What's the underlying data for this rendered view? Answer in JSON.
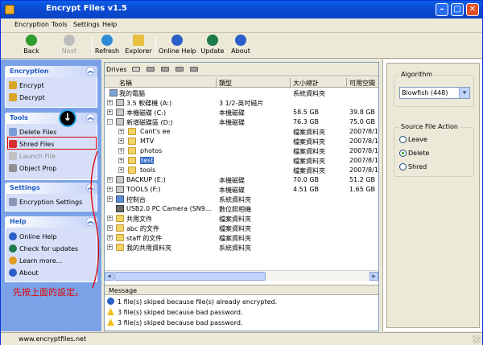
{
  "window": {
    "title": "Encrypt Files v1.5",
    "min_icon": "minimize-icon",
    "max_icon": "maximize-icon",
    "close_icon": "close-icon"
  },
  "menu": [
    {
      "label": "Encryption"
    },
    {
      "label": "Tools"
    },
    {
      "label": "Settings"
    },
    {
      "label": "Help"
    }
  ],
  "toolbar": {
    "back": "Back",
    "next": "Next",
    "refresh": "Refresh",
    "explorer": "Explorer",
    "online_help": "Online Help",
    "update": "Update",
    "about": "About"
  },
  "sidebar": {
    "encryption": {
      "header": "Encryption",
      "items": [
        "Encrypt",
        "Decrypt"
      ]
    },
    "tools": {
      "header": "Tools",
      "items": [
        "Delete Files",
        "Shred Files",
        "Launch File",
        "Object Prop"
      ]
    },
    "settings": {
      "header": "Settings",
      "items": [
        "Encryption Settings"
      ]
    },
    "help": {
      "header": "Help",
      "items": [
        "Online Help",
        "Check for updates",
        "Learn more...",
        "About"
      ]
    }
  },
  "annotation": {
    "note": "先按上面的設定。"
  },
  "drives_label": "Drives",
  "columns": {
    "name": "名稱",
    "type": "類型",
    "size": "大小總計",
    "free": "可用空間"
  },
  "rows": [
    {
      "name": "我的電腦",
      "type": "",
      "size": "系統資料夾",
      "free": ""
    },
    {
      "name": "3.5 軟碟機 (A:)",
      "type": "3 1/2-英吋磁片",
      "size": "",
      "free": ""
    },
    {
      "name": "本機磁碟 (C:)",
      "type": "本機磁碟",
      "size": "58.5 GB",
      "free": "39.8 GB"
    },
    {
      "name": "新增磁碟區 (D:)",
      "type": "本機磁碟",
      "size": "76.3 GB",
      "free": "75.0 GB"
    },
    {
      "name": "Cant's ee",
      "type": "",
      "size": "檔案資料夾",
      "free": "2007/8/1"
    },
    {
      "name": "MTV",
      "type": "",
      "size": "檔案資料夾",
      "free": "2007/8/1"
    },
    {
      "name": "photos",
      "type": "",
      "size": "檔案資料夾",
      "free": "2007/8/1"
    },
    {
      "name": "test",
      "type": "",
      "size": "檔案資料夾",
      "free": "2007/8/1"
    },
    {
      "name": "tools",
      "type": "",
      "size": "檔案資料夾",
      "free": "2007/8/1"
    },
    {
      "name": "BACKUP (E:)",
      "type": "本機磁碟",
      "size": "70.0 GB",
      "free": "51.2 GB"
    },
    {
      "name": "TOOLS (F:)",
      "type": "本機磁碟",
      "size": "4.51 GB",
      "free": "1.65 GB"
    },
    {
      "name": "控制台",
      "type": "系統資料夾",
      "size": "",
      "free": ""
    },
    {
      "name": "USB2.0 PC Camera (SN9...",
      "type": "數位照相機",
      "size": "",
      "free": ""
    },
    {
      "name": "共用文件",
      "type": "檔案資料夾",
      "size": "",
      "free": ""
    },
    {
      "name": "abc 的文件",
      "type": "檔案資料夾",
      "size": "",
      "free": ""
    },
    {
      "name": "staff 的文件",
      "type": "檔案資料夾",
      "size": "",
      "free": ""
    },
    {
      "name": "我的共用資料夾",
      "type": "系統資料夾",
      "size": "",
      "free": ""
    }
  ],
  "messages": {
    "header": "Message",
    "items": [
      "1 file(s) skiped because file(s) already encrypted.",
      "3 file(s) skiped because bad password.",
      "3 file(s) skiped because bad password."
    ]
  },
  "right": {
    "algorithm_label": "Algorithm",
    "algorithm_value": "Blowfish (448)",
    "source_label": "Source File Action",
    "options": [
      "Leave",
      "Delete",
      "Shred"
    ],
    "selected": "Delete"
  },
  "status": {
    "url": "www.encryptfiles.net"
  },
  "colors": {
    "title_bar": "#0a4fd6",
    "left_pane": "#7ba2e7",
    "selection": "#316ac5",
    "annotation": "#e00000"
  }
}
